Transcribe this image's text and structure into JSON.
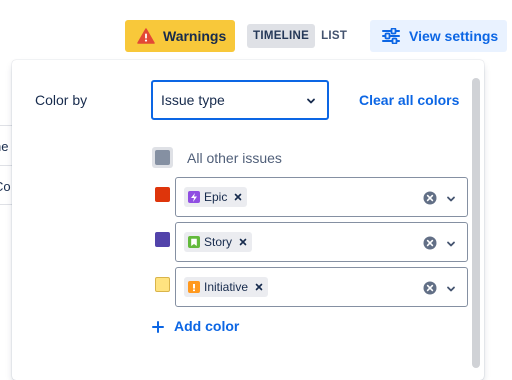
{
  "background": {
    "row_texts": [
      "ne",
      "Co"
    ]
  },
  "toolbar": {
    "warnings_label": "Warnings",
    "warning_icon": "warning-icon",
    "view_toggle": [
      {
        "label": "TIMELINE",
        "active": true
      },
      {
        "label": "LIST",
        "active": false
      }
    ],
    "view_settings_label": "View settings",
    "view_settings_icon": "sliders-icon"
  },
  "color_panel": {
    "color_by_label": "Color by",
    "color_by_value": "Issue type",
    "clear_all_label": "Clear all colors",
    "other_issues_label": "All other issues",
    "mappings": [
      {
        "swatch": "#de350b",
        "tag_label": "Epic",
        "tag_icon": "epic-icon",
        "tag_color": "#904ee2"
      },
      {
        "swatch": "#5243aa",
        "tag_label": "Story",
        "tag_icon": "story-icon",
        "tag_color": "#63ba3c"
      },
      {
        "swatch": "#ffe380",
        "tag_label": "Initiative",
        "tag_icon": "initiative-icon",
        "tag_color": "#ff991f"
      }
    ],
    "add_color_label": "Add color"
  },
  "colors": {
    "accent": "#0c66e4",
    "warning": "#f8c83a",
    "other_swatch": "#8590a2"
  }
}
